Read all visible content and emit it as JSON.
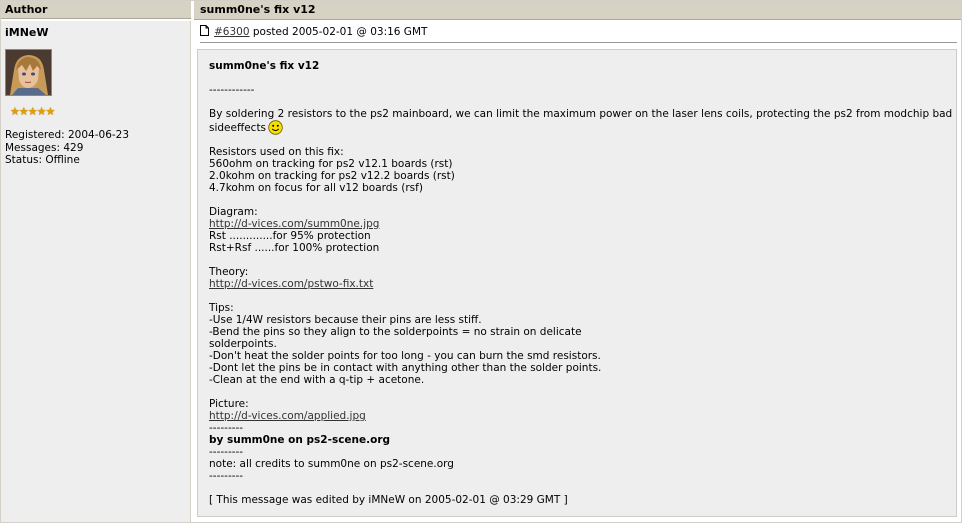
{
  "header": {
    "author_label": "Author",
    "topic_title": "summ0ne's fix v12"
  },
  "user": {
    "name": "iMNeW",
    "stars": "★★★★★",
    "registered": "Registered: 2004-06-23",
    "messages": "Messages: 429",
    "status": "Status: Offline"
  },
  "post": {
    "id_link": "#6300",
    "posted_text": " posted 2005-02-01 @ 03:16 GMT",
    "title": "summ0ne's fix v12",
    "sep1": "------------",
    "intro_1": "By soldering 2 resistors to the ps2 mainboard, we can limit the maximum power on the laser lens coils, protecting the ps2 from modchip bad",
    "intro_2": "sideeffects",
    "res_head": "Resistors used on this fix:",
    "res_1": "560ohm on tracking for ps2 v12.1 boards (rst)",
    "res_2": "2.0kohm on tracking for ps2 v12.2 boards (rst)",
    "res_3": "4.7kohm on focus for all v12 boards (rsf)",
    "diag_head": "Diagram:",
    "diag_link": "http://d-vices.com/summ0ne.jpg",
    "diag_1": "Rst .............for 95% protection",
    "diag_2": "Rst+Rsf ......for 100% protection",
    "theory_head": "Theory:",
    "theory_link": "http://d-vices.com/pstwo-fix.txt",
    "tips_head": "Tips:",
    "tip_1": "-Use 1/4W resistors because their pins are less stiff.",
    "tip_2": "-Bend the pins so they align to the solderpoints = no strain on delicate",
    "tip_2b": "solderpoints.",
    "tip_3": "-Don't heat the solder points for too long - you can burn the smd resistors.",
    "tip_4": "-Dont let the pins be in contact with anything other than the solder points.",
    "tip_5": "-Clean at the end with a q-tip + acetone.",
    "pic_head": "Picture:",
    "pic_link": "http://d-vices.com/applied.jpg",
    "dash1": "---------",
    "by_line": "by summ0ne on ps2-scene.org",
    "dash2": "---------",
    "note": "note: all credits to summ0ne on ps2-scene.org",
    "dash3": "---------",
    "edited": "[ This message was edited by iMNeW on 2005-02-01 @ 03:29 GMT ]"
  },
  "colors": {
    "header_bg": "#d6d3c4",
    "panel_bg": "#eeeeee",
    "star": "#e0a000"
  },
  "icons": [
    "document-icon",
    "smiley-icon",
    "avatar-image"
  ]
}
